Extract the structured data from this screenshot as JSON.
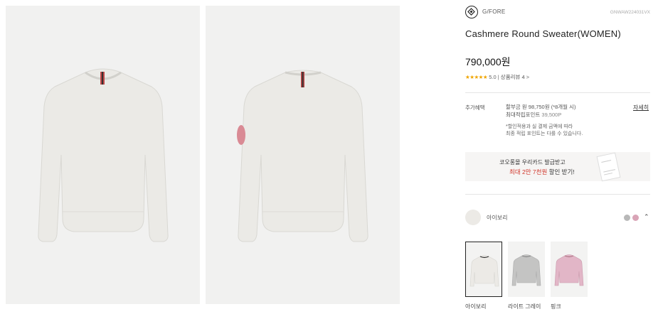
{
  "product": {
    "brand": "G/FORE",
    "code": "GNWAW224031VX",
    "title": "Cashmere Round Sweater(WOMEN)",
    "price": "790,000원",
    "rating": {
      "stars": "★★★★★",
      "score": "5.0",
      "separator": "|",
      "review_label": "상품리뷰 4",
      "chevron": ">"
    }
  },
  "benefits": {
    "label": "추가혜택",
    "installment_line": "할부금 원 98,750원 (*8개월 시)",
    "points_prefix": "최대적립포인트",
    "points_value": "39,500P",
    "note_1": "*할인적용과 실 결제 금액에 따라",
    "note_2": "최종 적립 포인트는 다를 수 있습니다.",
    "detail_link": "자세히"
  },
  "promo": {
    "line1": "코오롱몰 우리카드 발급받고",
    "line2_pre": "최대 2만 7천원",
    "line2_post": "할인 받기!"
  },
  "color_select": {
    "selected_label": "아이보리",
    "chevron": "⌃",
    "swatch_colors": [
      "#b8b8b8",
      "#d9a4b6"
    ]
  },
  "color_options": [
    {
      "label": "아이보리",
      "color": "#eceae6"
    },
    {
      "label": "라이트 그레이",
      "color": "#c4c4c3"
    },
    {
      "label": "핑크",
      "color": "#e2b6c7"
    }
  ],
  "colors": {
    "sweater_ivory": "#eceae6",
    "background": "#f1f1f0",
    "accent_red": "#d0352a",
    "star": "#f0a500"
  }
}
